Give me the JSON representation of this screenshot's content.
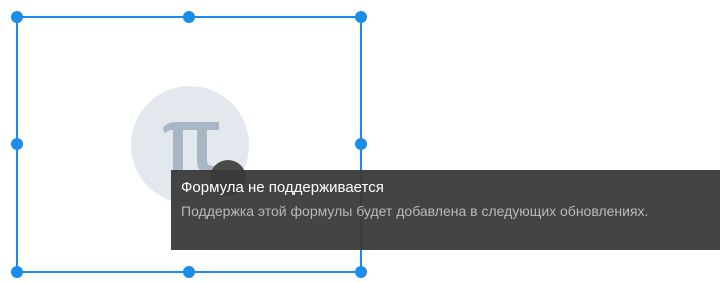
{
  "tooltip": {
    "title": "Формула не поддерживается",
    "message": "Поддержка этой формулы будет добавлена в следующих обновлениях."
  },
  "formula_placeholder": {
    "icon": "pi-icon"
  },
  "colors": {
    "selection": "#1a8cea",
    "placeholder_bg": "#e3e8ef",
    "placeholder_glyph": "#a8b6c6",
    "tooltip_bg": "#3a3a3a"
  }
}
